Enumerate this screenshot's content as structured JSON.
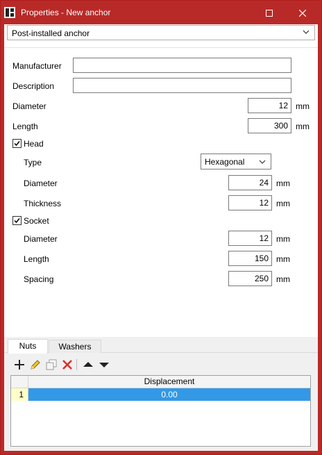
{
  "window": {
    "title": "Properties - New anchor",
    "accent_color": "#b82a28",
    "buttons": [
      "maximize-icon",
      "close-icon"
    ]
  },
  "anchor_type": {
    "value": "Post-installed anchor",
    "icon": "chevron-down-icon"
  },
  "form": {
    "manufacturer": {
      "label": "Manufacturer",
      "value": ""
    },
    "description": {
      "label": "Description",
      "value": ""
    },
    "diameter": {
      "label": "Diameter",
      "value": "12",
      "unit": "mm"
    },
    "length": {
      "label": "Length",
      "value": "300",
      "unit": "mm"
    },
    "head": {
      "label": "Head",
      "checked": true,
      "type": {
        "label": "Type",
        "value": "Hexagonal"
      },
      "diameter": {
        "label": "Diameter",
        "value": "24",
        "unit": "mm"
      },
      "thickness": {
        "label": "Thickness",
        "value": "12",
        "unit": "mm"
      }
    },
    "socket": {
      "label": "Socket",
      "checked": true,
      "diameter": {
        "label": "Diameter",
        "value": "12",
        "unit": "mm"
      },
      "length": {
        "label": "Length",
        "value": "150",
        "unit": "mm"
      },
      "spacing": {
        "label": "Spacing",
        "value": "250",
        "unit": "mm"
      }
    }
  },
  "tabs": [
    {
      "label": "Nuts",
      "active": true
    },
    {
      "label": "Washers",
      "active": false
    }
  ],
  "toolbar": [
    "add-icon",
    "edit-icon",
    "copy-icon",
    "delete-icon",
    "move-up-icon",
    "move-down-icon"
  ],
  "table": {
    "columns": [
      "Displacement"
    ],
    "rows": [
      {
        "index": "1",
        "displacement": "0.00",
        "selected": true
      }
    ],
    "selection_color": "#3399e6"
  }
}
